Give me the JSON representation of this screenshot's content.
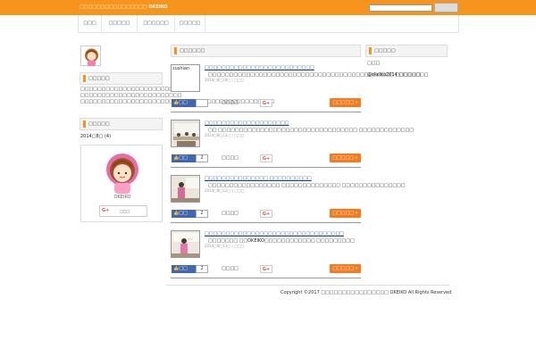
{
  "header": {
    "site_title": "□□□□□□□□□□□□□□□□ OKEIKO",
    "search_button_label": ""
  },
  "nav": {
    "items": [
      {
        "label": "□□□"
      },
      {
        "label": "□□□□□"
      },
      {
        "label": "□□□□□□"
      },
      {
        "label": "□□□□□"
      }
    ]
  },
  "sidebar_left": {
    "about_heading": "□□□□□",
    "about_text": "□□□□□□□□□□□□□□□□□□□□□□□□□□□ □□□□□□□□□□□□□□□□□□□□□□□□ □□□□□□□□□□□□□□□□□□□□□□□□□□□□□□□□□□□□□□□□□□□□□□",
    "archive_heading": "□□□□□",
    "archive_link": "2014□8□ (4)",
    "profile_name": "OKEIKO",
    "profile_button_label": "□□□",
    "profile_gplus": "G+"
  },
  "main": {
    "heading": "□□□□□□",
    "posts": [
      {
        "title": "□□□□□□□□□□□□□□□□□□□□□□□□□□",
        "excerpt": "□□□□□□□□□□□□□□□□□□□□□□□□□□□□□□□□□□□□□□□□□□□□ □□□□□□",
        "meta": "2014□8□19□ | □□□",
        "thumb_alt": "sushian",
        "fb_label": "□□",
        "fb_count": "",
        "hatena": "□□□□",
        "gplus": "G+",
        "more": "□□□□□ »"
      },
      {
        "title": "□□□□□□□□□□□□□□□□□□□□",
        "excerpt": "□□ □□□□□□□□□□□□□□□□□□□□□□□□□□□□□□□□□ □□□□□□□□□□□□□",
        "meta": "2014□8□13□ | □□□",
        "thumb_alt": "",
        "fb_label": "□□",
        "fb_count": "2",
        "hatena": "□□□□",
        "gplus": "G+",
        "more": "□□□□□ »"
      },
      {
        "title": "□□□□□□□□□□□□□□□ □□□□□□□□□□",
        "excerpt": "□□□□□□□□□□□□□□□□□ □□□□□□□□□□□□□□ □□□□□□□□□□□□□□□",
        "meta": "2014□8□12□ | □□□",
        "thumb_alt": "",
        "fb_label": "□□",
        "fb_count": "2",
        "hatena": "□□□□",
        "gplus": "G+",
        "more": "□□□□□ »"
      },
      {
        "title": "□□□□□□□□□□□□□□□□□□□□□□□□□□□□□□□□□",
        "excerpt": "□□□□□□□ □□OKEIKO□□□□□□□□□□□□ □□□□□□□□□",
        "meta": "2014□8□11□ | □□□",
        "thumb_alt": "",
        "fb_label": "□□",
        "fb_count": "2",
        "hatena": "□□□□",
        "gplus": "G+",
        "more": "□□□□□ »"
      }
    ]
  },
  "sidebar_right": {
    "heading": "□□□□□",
    "line1": "□□□",
    "twitter": "@okeiko2014 □□□□□□□"
  },
  "footer": {
    "copyright": "Copyright ©2017 □□□□□□□□□□□□□□□□ OKEIKO All Rights Reserved"
  },
  "colors": {
    "accent": "#f7941d",
    "facebook": "#4267b2",
    "more_button": "#f47b20"
  }
}
